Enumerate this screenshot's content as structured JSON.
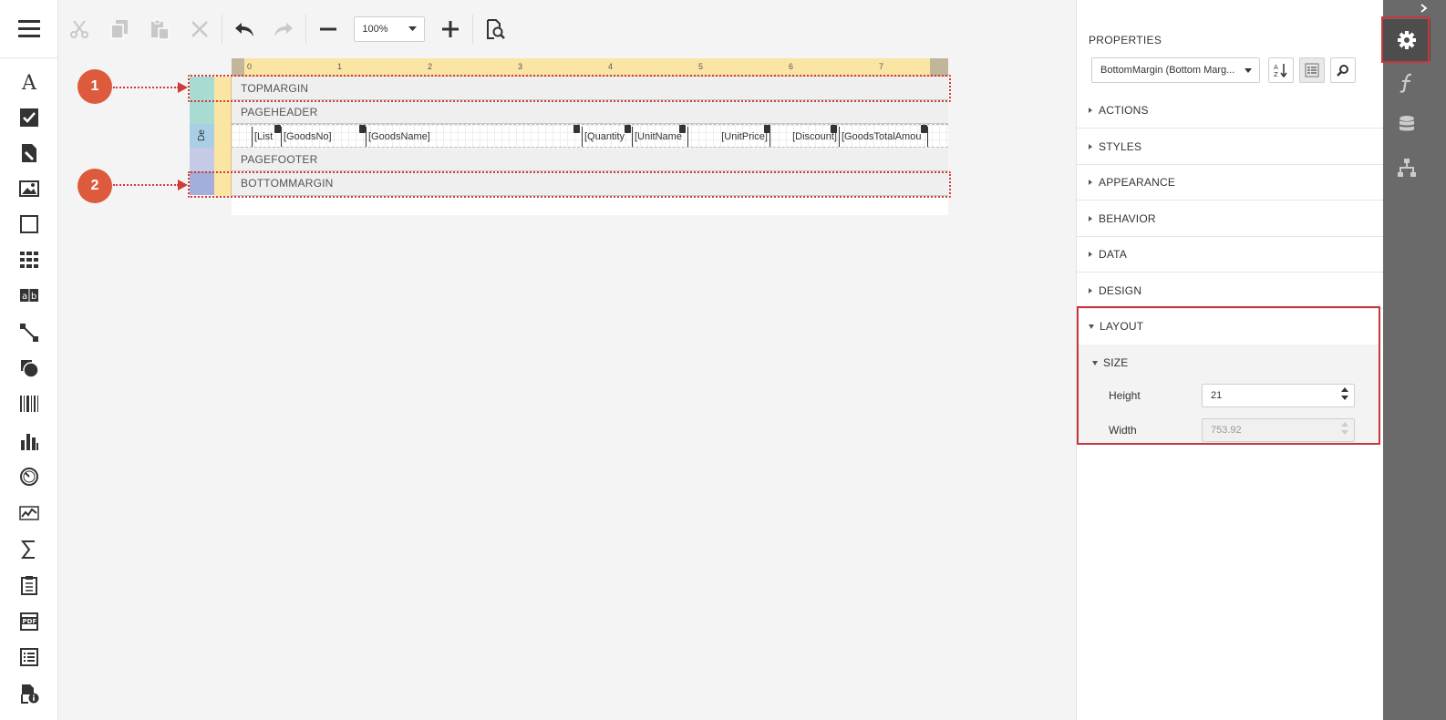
{
  "toolbar": {
    "zoom": "100%",
    "buttons": [
      "cut-icon",
      "copy-icon",
      "paste-icon",
      "delete-icon",
      "undo-icon",
      "redo-icon",
      "zoom-out-icon",
      "zoom-in-icon",
      "preview-icon"
    ]
  },
  "toolbox": {
    "items": [
      "label-icon",
      "checkbox-icon",
      "rich-text-icon",
      "picture-icon",
      "panel-icon",
      "table-icon",
      "character-comb-icon",
      "line-icon",
      "shape-icon",
      "barcode-icon",
      "chart-icon",
      "gauge-icon",
      "sparkline-icon",
      "summary-icon",
      "subreport-icon",
      "pdf-content-icon",
      "table-of-contents-icon",
      "page-info-icon"
    ]
  },
  "report": {
    "ruler_ticks": [
      "0",
      "1",
      "2",
      "3",
      "4",
      "5",
      "6",
      "7"
    ],
    "bands": {
      "top_margin": "TOPMARGIN",
      "page_header": "PAGEHEADER",
      "detail_tag": "De",
      "page_footer": "PAGEFOOTER",
      "bottom_margin": "BOTTOMMARGIN"
    },
    "detail_cells": [
      "[List",
      "[GoodsNo]",
      "[GoodsName]",
      "[Quantity",
      "[UnitName",
      "[UnitPrice]",
      "[Discount]",
      "[GoodsTotalAmou"
    ]
  },
  "callouts": [
    "1",
    "2"
  ],
  "properties": {
    "title": "PROPERTIES",
    "selected_component": "BottomMargin (Bottom Marg...",
    "groups": [
      "ACTIONS",
      "STYLES",
      "APPEARANCE",
      "BEHAVIOR",
      "DATA",
      "DESIGN",
      "LAYOUT"
    ],
    "size_section": "SIZE",
    "height_label": "Height",
    "height_value": "21",
    "width_label": "Width",
    "width_value": "753.92"
  },
  "right_tabs": [
    "properties-tab-icon",
    "expressions-tab-icon",
    "field-list-tab-icon",
    "report-explorer-tab-icon"
  ],
  "colors": {
    "accent_red": "#c9363f",
    "callout": "#de5a3c",
    "ruler": "#fbe5a5",
    "tabs_bg": "#6a6a6a"
  }
}
